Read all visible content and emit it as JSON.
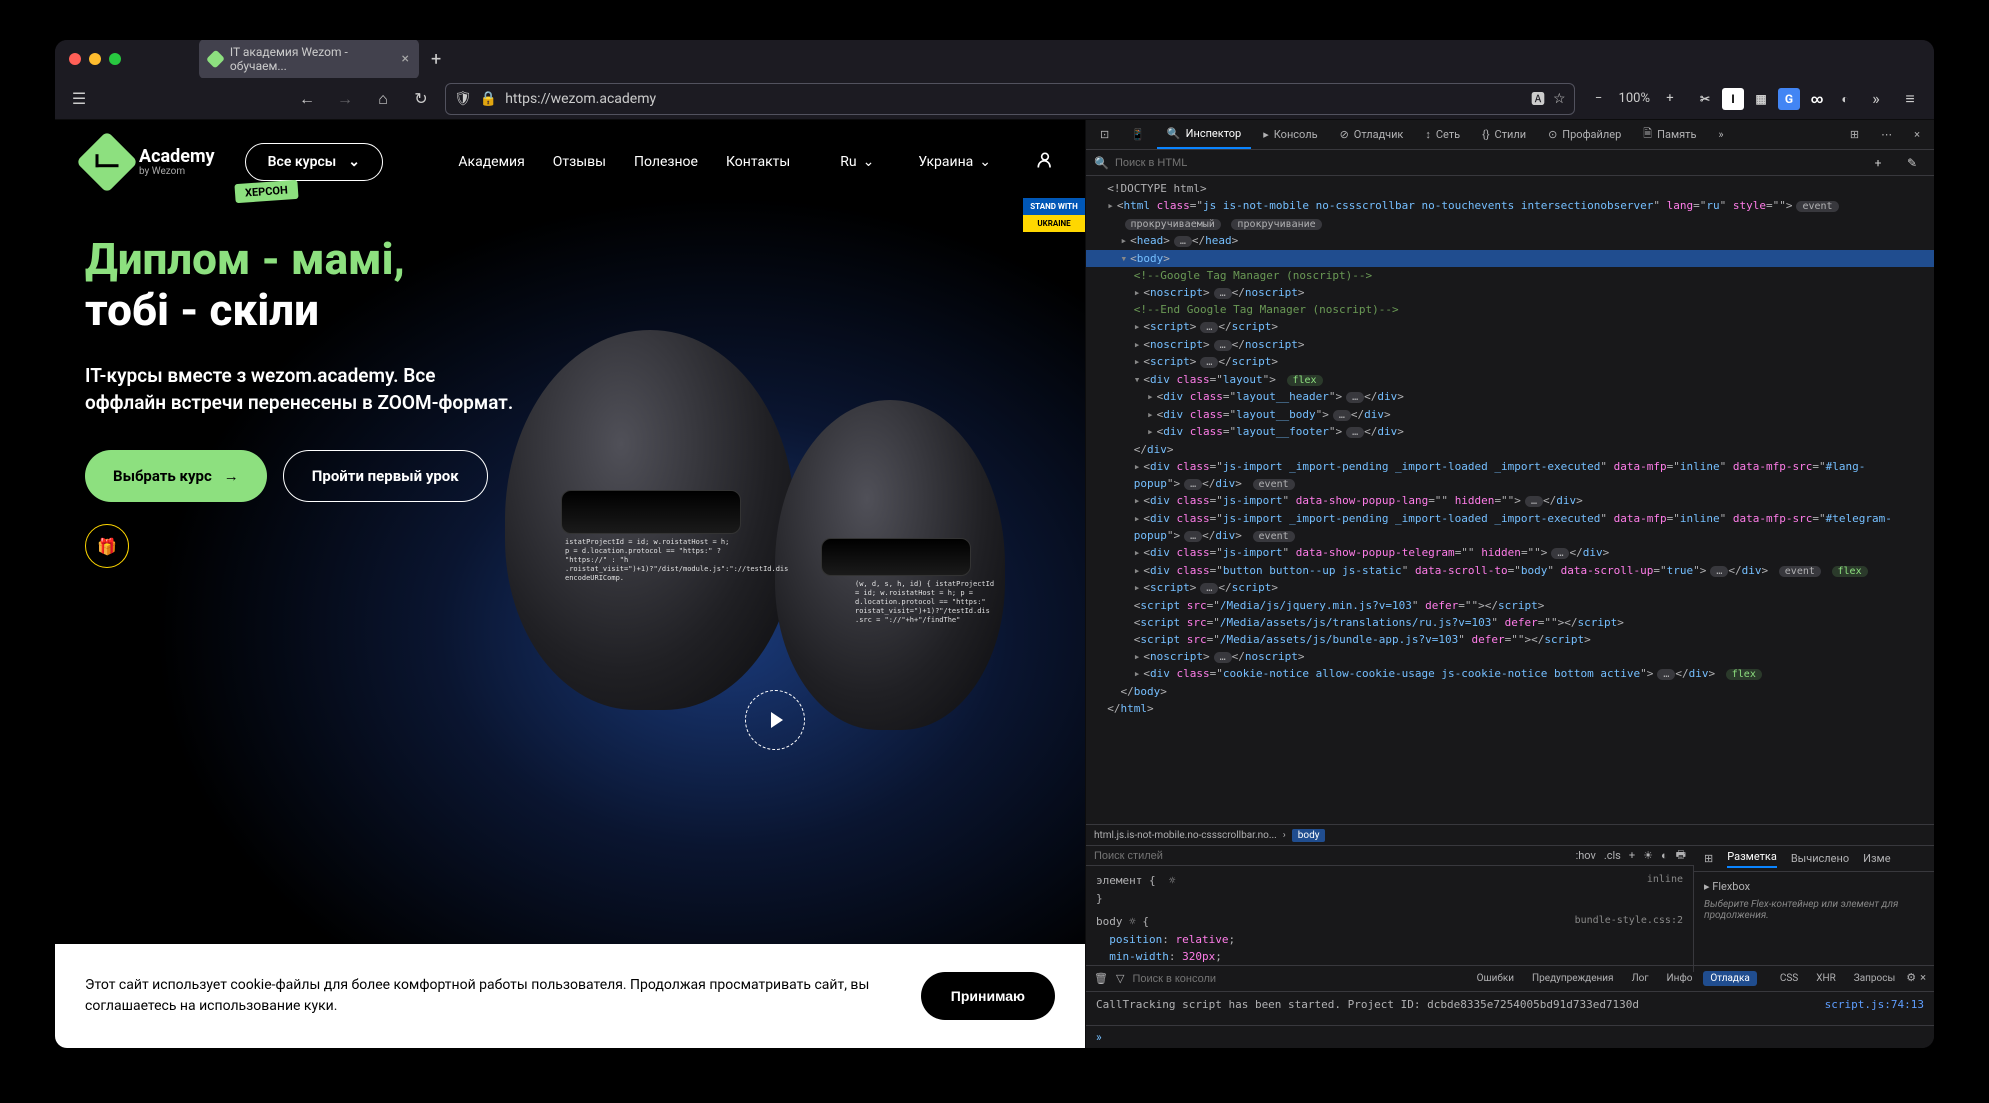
{
  "browser": {
    "tab_title": "IT академия Wezom - обучаем...",
    "url": "https://wezom.academy",
    "zoom": "100%"
  },
  "site": {
    "logo_title": "Academy",
    "logo_sub": "by Wezom",
    "badge": "ХЕРСОН",
    "all_courses": "Все курсы",
    "nav": [
      "Академия",
      "Отзывы",
      "Полезное",
      "Контакты"
    ],
    "lang": "Ru",
    "country": "Украина",
    "stand_top": "STAND WITH",
    "stand_bot": "UKRAINE",
    "hero_green": "Диплом - мамі,",
    "hero_white": "тобі - скіли",
    "hero_sub": "IT-курсы вместе з wezom.academy. Все оффлайн встречи перенесены в ZOOM-формат.",
    "btn_primary": "Выбрать курс",
    "btn_outline": "Пройти первый урок",
    "cookie_text": "Этот сайт использует cookie-файлы для более комфортной работы пользователя. Продолжая просматривать сайт, вы соглашаетесь на использование куки.",
    "cookie_btn": "Принимаю",
    "code_snip1": "istatProjectId = id; w.roistatHost = h;\np = d.location.protocol == \"https:\" ? \"https://\" : \"h\n.roistat_visit=\")+1)?\"/dist/module.js\":\"://testId.dis\nencodeURIComp.",
    "code_snip2": "(w, d, s, h, id) {\nistatProjectId = id; w.roistatHost = h;\np = d.location.protocol == \"https:\"\nroistat_visit=\")+1)?\"/testId.dis\n.src = \"://\"+h+\"/findThe\""
  },
  "devtools": {
    "tabs": [
      "Инспектор",
      "Консоль",
      "Отладчик",
      "Сеть",
      "Стили",
      "Профайлер",
      "Память"
    ],
    "search_placeholder": "Поиск в HTML",
    "crumbs_left": "html.js.is-not-mobile.no-cssscrollbar.no...",
    "crumbs_active": "body",
    "styles_toolbar": [
      ":hov",
      ".cls"
    ],
    "layout_tabs": [
      "Разметка",
      "Вычислено",
      "Изме"
    ],
    "flexbox_title": "▸ Flexbox",
    "flexbox_hint": "Выберите Flex-контейнер или элемент для продолжения.",
    "console_search": "Поиск в консоли",
    "console_filters": [
      "Ошибки",
      "Предупреждения",
      "Лог",
      "Инфо",
      "Отладка"
    ],
    "console_cats": [
      "CSS",
      "XHR",
      "Запросы"
    ],
    "console_msg": "CallTracking script has been started. Project ID: dcbde8335e7254005bd91d733ed7130d",
    "console_src": "script.js:74:13",
    "styles_filter_placeholder": "Поиск стилей",
    "rules": {
      "element_sel": "элемент {",
      "element_src": "inline",
      "body_sel": "body ☼ {",
      "body_src": "bundle-style.css:2",
      "body_props": [
        {
          "p": "position",
          "v": "relative"
        },
        {
          "p": "min-width",
          "v": "320px"
        }
      ]
    },
    "dom": [
      {
        "i": 1,
        "t": "<!DOCTYPE html>"
      },
      {
        "i": 1,
        "h": "<span class='tw'>▸</span>&lt;<span class='tag'>html</span> <span class='attr'>class</span>=\"<span class='val'>js is-not-mobile no-cssscrollbar no-touchevents intersectionobserver</span>\" <span class='attr'>lang</span>=\"<span class='val'>ru</span>\" <span class='attr'>style</span>=\"\"&gt;<span class='pill'>event</span>"
      },
      {
        "i": 2,
        "h": "<span class='pill'>прокручиваемый</span> <span class='pill'>прокручивание</span>"
      },
      {
        "i": 2,
        "h": "<span class='tw'>▸</span>&lt;<span class='tag'>head</span>&gt;<span class='pill'>…</span>&lt;/<span class='tag'>head</span>&gt;"
      },
      {
        "i": 2,
        "h": "<span class='tw'>▾</span>&lt;<span class='tag'>body</span>&gt;",
        "sel": true
      },
      {
        "i": 3,
        "h": "<span class='cm'>&lt;!--Google Tag Manager (noscript)--&gt;</span>"
      },
      {
        "i": 3,
        "h": "<span class='tw'>▸</span>&lt;<span class='tag'>noscript</span>&gt;<span class='pill'>…</span>&lt;/<span class='tag'>noscript</span>&gt;"
      },
      {
        "i": 3,
        "h": "<span class='cm'>&lt;!--End Google Tag Manager (noscript)--&gt;</span>"
      },
      {
        "i": 3,
        "h": "<span class='tw'>▸</span>&lt;<span class='tag'>script</span>&gt;<span class='pill'>…</span>&lt;/<span class='tag'>script</span>&gt;"
      },
      {
        "i": 3,
        "h": "<span class='tw'>▸</span>&lt;<span class='tag'>noscript</span>&gt;<span class='pill'>…</span>&lt;/<span class='tag'>noscript</span>&gt;"
      },
      {
        "i": 3,
        "h": "<span class='tw'>▸</span>&lt;<span class='tag'>script</span>&gt;<span class='pill'>…</span>&lt;/<span class='tag'>script</span>&gt;"
      },
      {
        "i": 3,
        "h": "<span class='tw'>▾</span>&lt;<span class='tag'>div</span> <span class='attr'>class</span>=\"<span class='val'>layout</span>\"&gt; <span class='pill pillg'>flex</span>"
      },
      {
        "i": 4,
        "h": "<span class='tw'>▸</span>&lt;<span class='tag'>div</span> <span class='attr'>class</span>=\"<span class='val'>layout__header</span>\"&gt;<span class='pill'>…</span>&lt;/<span class='tag'>div</span>&gt;"
      },
      {
        "i": 4,
        "h": "<span class='tw'>▸</span>&lt;<span class='tag'>div</span> <span class='attr'>class</span>=\"<span class='val'>layout__body</span>\"&gt;<span class='pill'>…</span>&lt;/<span class='tag'>div</span>&gt;"
      },
      {
        "i": 4,
        "h": "<span class='tw'>▸</span>&lt;<span class='tag'>div</span> <span class='attr'>class</span>=\"<span class='val'>layout__footer</span>\"&gt;<span class='pill'>…</span>&lt;/<span class='tag'>div</span>&gt;"
      },
      {
        "i": 3,
        "h": "&lt;/<span class='tag'>div</span>&gt;"
      },
      {
        "i": 3,
        "h": "<span class='tw'>▸</span>&lt;<span class='tag'>div</span> <span class='attr'>class</span>=\"<span class='val'>js-import _import-pending _import-loaded _import-executed</span>\" <span class='attr'>data-mfp</span>=\"<span class='val'>inline</span>\" <span class='attr'>data-mfp-src</span>=\"<span class='val'>#lang-</span>"
      },
      {
        "i": 3,
        "h": "<span class='val'>popup</span>\"&gt;<span class='pill'>…</span>&lt;/<span class='tag'>div</span>&gt; <span class='pill'>event</span>"
      },
      {
        "i": 3,
        "h": "<span class='tw'>▸</span>&lt;<span class='tag'>div</span> <span class='attr'>class</span>=\"<span class='val'>js-import</span>\" <span class='attr'>data-show-popup-lang</span>=\"\" <span class='attr'>hidden</span>=\"\"&gt;<span class='pill'>…</span>&lt;/<span class='tag'>div</span>&gt;"
      },
      {
        "i": 3,
        "h": "<span class='tw'>▸</span>&lt;<span class='tag'>div</span> <span class='attr'>class</span>=\"<span class='val'>js-import _import-pending _import-loaded _import-executed</span>\" <span class='attr'>data-mfp</span>=\"<span class='val'>inline</span>\" <span class='attr'>data-mfp-src</span>=\"<span class='val'>#telegram-</span>"
      },
      {
        "i": 3,
        "h": "<span class='val'>popup</span>\"&gt;<span class='pill'>…</span>&lt;/<span class='tag'>div</span>&gt; <span class='pill'>event</span>"
      },
      {
        "i": 3,
        "h": "<span class='tw'>▸</span>&lt;<span class='tag'>div</span> <span class='attr'>class</span>=\"<span class='val'>js-import</span>\" <span class='attr'>data-show-popup-telegram</span>=\"\" <span class='attr'>hidden</span>=\"\"&gt;<span class='pill'>…</span>&lt;/<span class='tag'>div</span>&gt;"
      },
      {
        "i": 3,
        "h": "<span class='tw'>▸</span>&lt;<span class='tag'>div</span> <span class='attr'>class</span>=\"<span class='val'>button button--up js-static</span>\" <span class='attr'>data-scroll-to</span>=\"<span class='val'>body</span>\" <span class='attr'>data-scroll-up</span>=\"<span class='val'>true</span>\"&gt;<span class='pill'>…</span>&lt;/<span class='tag'>div</span>&gt; <span class='pill'>event</span> <span class='pill pillg'>flex</span>"
      },
      {
        "i": 3,
        "h": "<span class='tw'>▸</span>&lt;<span class='tag'>script</span>&gt;<span class='pill'>…</span>&lt;/<span class='tag'>script</span>&gt;"
      },
      {
        "i": 3,
        "h": "&lt;<span class='tag'>script</span> <span class='attr'>src</span>=\"<span class='val'>/Media/js/jquery.min.js?v=103</span>\" <span class='attr'>defer</span>=\"\"&gt;&lt;/<span class='tag'>script</span>&gt;"
      },
      {
        "i": 3,
        "h": "&lt;<span class='tag'>script</span> <span class='attr'>src</span>=\"<span class='val'>/Media/assets/js/translations/ru.js?v=103</span>\" <span class='attr'>defer</span>=\"\"&gt;&lt;/<span class='tag'>script</span>&gt;"
      },
      {
        "i": 3,
        "h": "&lt;<span class='tag'>script</span> <span class='attr'>src</span>=\"<span class='val'>/Media/assets/js/bundle-app.js?v=103</span>\" <span class='attr'>defer</span>=\"\"&gt;&lt;/<span class='tag'>script</span>&gt;"
      },
      {
        "i": 3,
        "h": "<span class='tw'>▸</span>&lt;<span class='tag'>noscript</span>&gt;<span class='pill'>…</span>&lt;/<span class='tag'>noscript</span>&gt;"
      },
      {
        "i": 3,
        "h": "<span class='tw'>▸</span>&lt;<span class='tag'>div</span> <span class='attr'>class</span>=\"<span class='val'>cookie-notice allow-cookie-usage js-cookie-notice bottom active</span>\"&gt;<span class='pill'>…</span>&lt;/<span class='tag'>div</span>&gt; <span class='pill pillg'>flex</span>"
      },
      {
        "i": 2,
        "h": "&lt;/<span class='tag'>body</span>&gt;"
      },
      {
        "i": 1,
        "h": "&lt;/<span class='tag'>html</span>&gt;"
      }
    ]
  }
}
